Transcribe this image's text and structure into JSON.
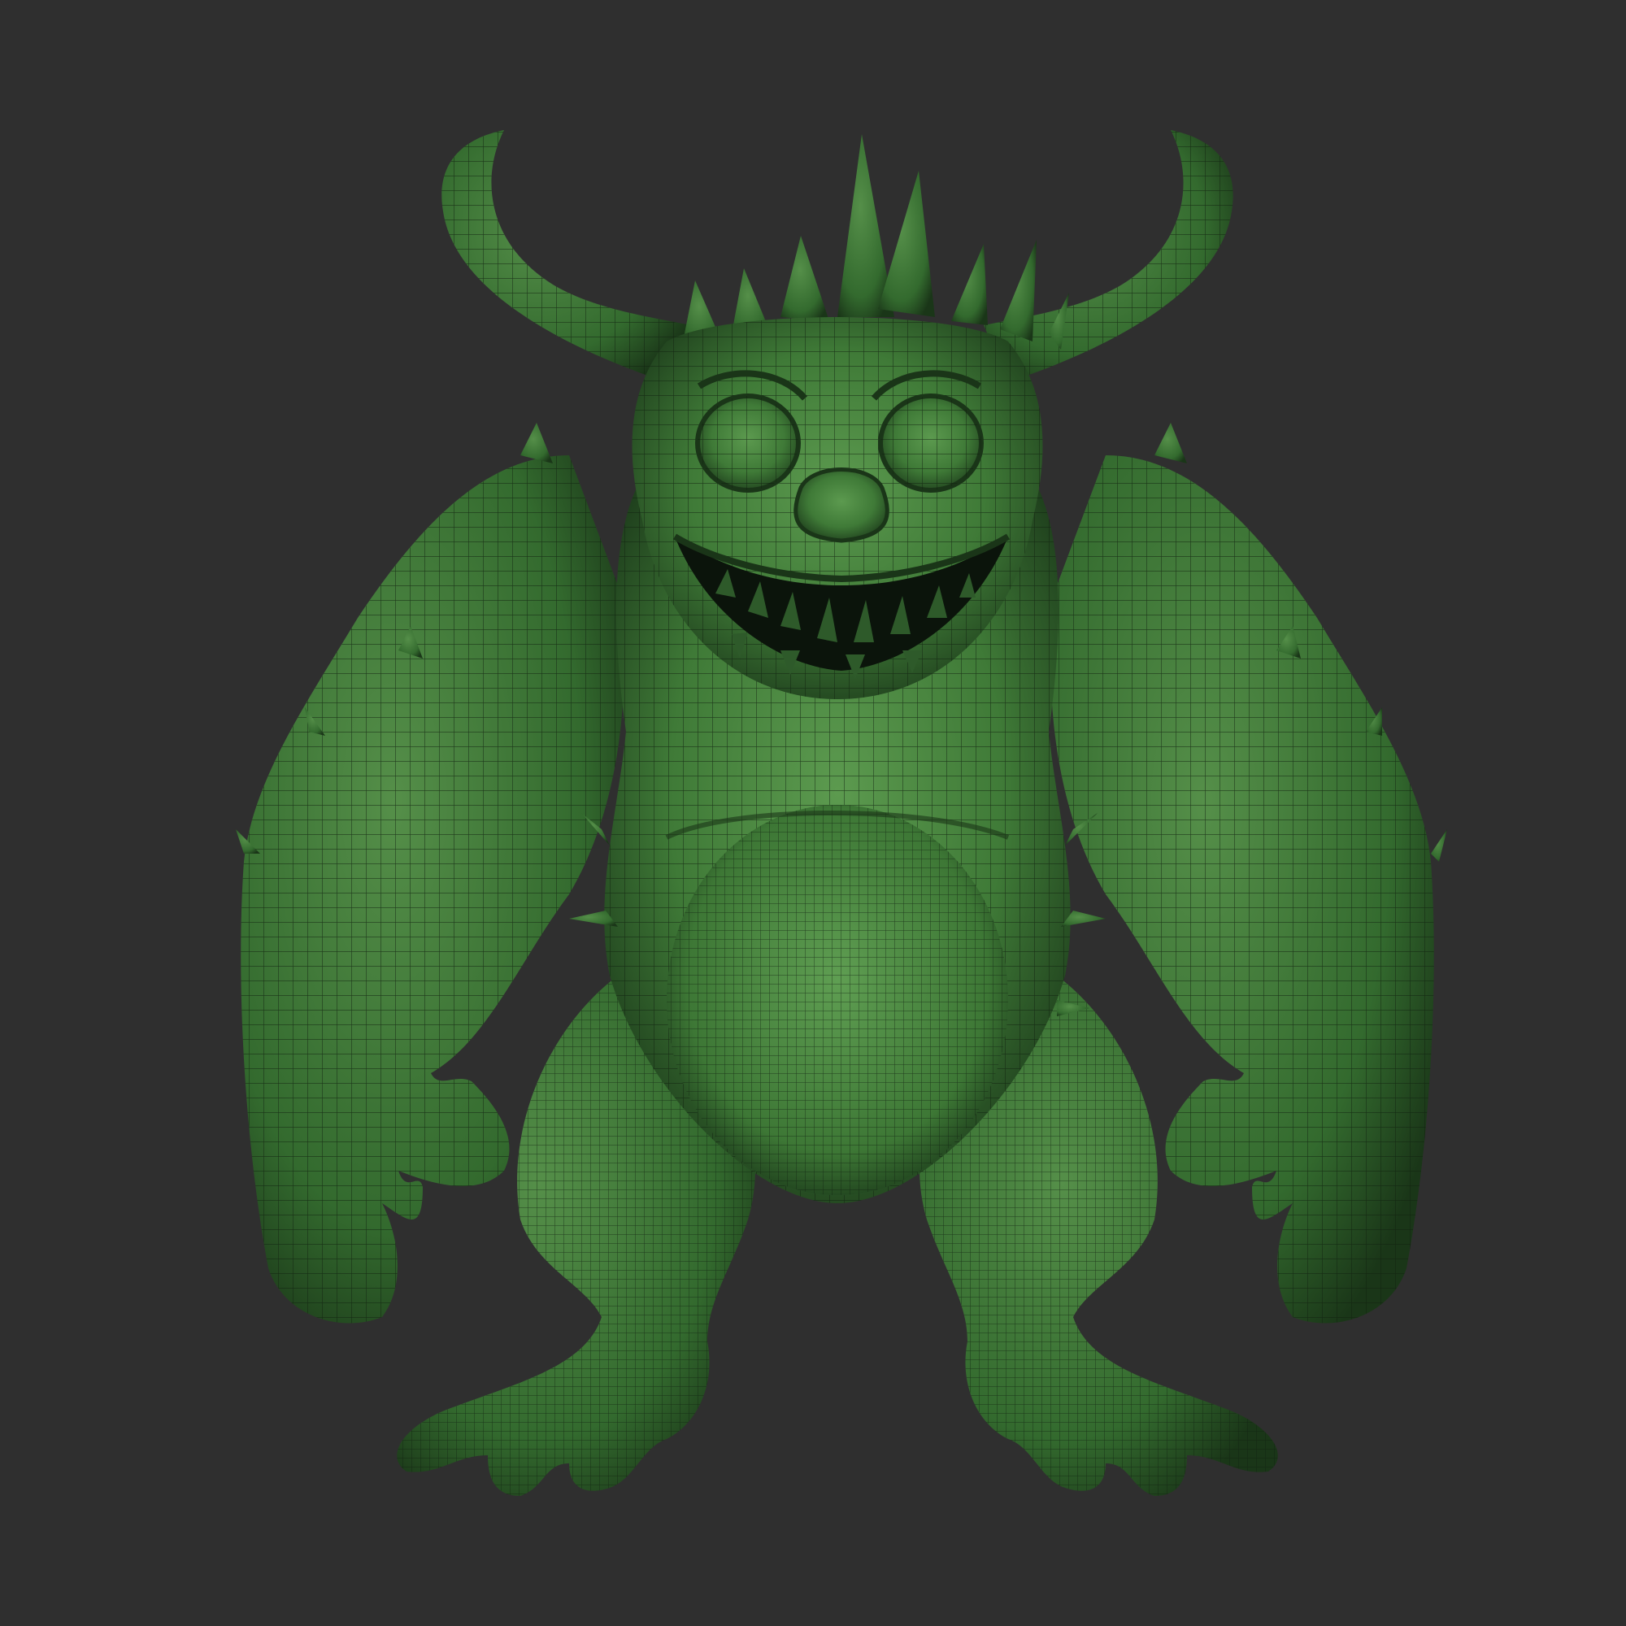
{
  "scene": {
    "subject_icon": "green-wireframe-monster-icon",
    "colors": {
      "background": "#2f2f2f",
      "skin_light": "#5c9a4f",
      "skin_mid": "#3f7a37",
      "skin_dark": "#1e3e1c",
      "wire": "#10200f",
      "mouth": "#0b140b",
      "teeth": "#2e5a2a"
    }
  }
}
